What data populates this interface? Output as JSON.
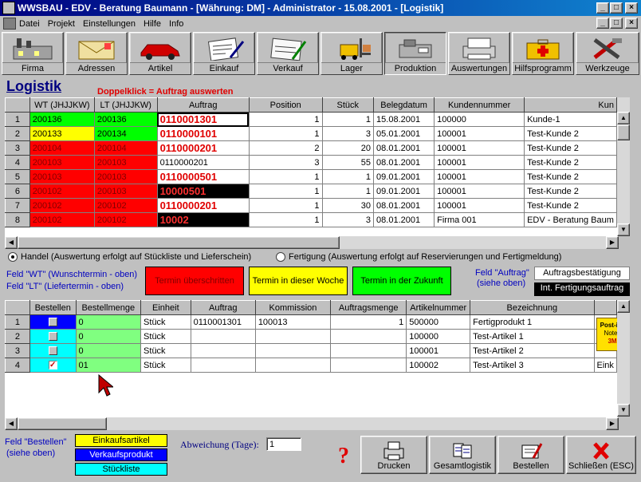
{
  "window": {
    "title": "WWSBAU - EDV - Beratung Baumann - [Währung: DM] - Administrator - 15.08.2001 - [Logistik]",
    "btn_min": "_",
    "btn_max": "□",
    "btn_close": "×"
  },
  "menu": [
    "Datei",
    "Projekt",
    "Einstellungen",
    "Hilfe",
    "Info"
  ],
  "toolbar": [
    "Firma",
    "Adressen",
    "Artikel",
    "Einkauf",
    "Verkauf",
    "Lager",
    "Produktion",
    "Auswertungen",
    "Hilfsprogramm",
    "Werkzeuge"
  ],
  "page": {
    "title": "Logistik",
    "hint": "Doppelklick = Auftrag auswerten"
  },
  "grid1": {
    "columns": [
      "WT (JHJJKW)",
      "LT (JHJJKW)",
      "Auftrag",
      "Position",
      "Stück",
      "Belegdatum",
      "Kundennummer",
      "Kun"
    ],
    "rows": [
      [
        "1",
        "200136",
        "200136",
        "0110001301",
        "1",
        "1",
        "15.08.2001",
        "100000",
        "Kunde-1"
      ],
      [
        "2",
        "200133",
        "200134",
        "0110000101",
        "1",
        "3",
        "05.01.2001",
        "100001",
        "Test-Kunde 2"
      ],
      [
        "3",
        "200104",
        "200104",
        "0110000201",
        "2",
        "20",
        "08.01.2001",
        "100001",
        "Test-Kunde 2"
      ],
      [
        "4",
        "200103",
        "200103",
        "0110000201",
        "3",
        "55",
        "08.01.2001",
        "100001",
        "Test-Kunde 2"
      ],
      [
        "5",
        "200103",
        "200103",
        "0110000501",
        "1",
        "1",
        "09.01.2001",
        "100001",
        "Test-Kunde 2"
      ],
      [
        "6",
        "200102",
        "200103",
        "10000501",
        "1",
        "1",
        "09.01.2001",
        "100001",
        "Test-Kunde 2"
      ],
      [
        "7",
        "200102",
        "200102",
        "0110000201",
        "1",
        "30",
        "08.01.2001",
        "100001",
        "Test-Kunde 2"
      ],
      [
        "8",
        "200102",
        "200102",
        "10002",
        "1",
        "3",
        "08.01.2001",
        "Firma 001",
        "EDV - Beratung Baum"
      ]
    ]
  },
  "radio": {
    "handel": "Handel (Auswertung erfolgt auf Stückliste und Lieferschein)",
    "fertigung": "Fertigung (Auswertung erfolgt auf Reservierungen und Fertigmeldung)"
  },
  "legend": {
    "note1": "Feld  \"WT\" (Wunschtermin - oben)",
    "note2": "Feld  \"LT\" (Liefertermin - oben)",
    "red": "Termin überschritten",
    "yellow": "Termin in dieser Woche",
    "green": "Termin in der Zukunft",
    "auftrag_note1": "Feld  \"Auftrag\"",
    "auftrag_note2": "(siehe oben)",
    "ab": "Auftragsbestätigung",
    "fa": "Int. Fertigungsauftrag"
  },
  "grid2": {
    "columns": [
      "Bestellen",
      "Bestellmenge",
      "Einheit",
      "Auftrag",
      "Kommission",
      "Auftragsmenge",
      "Artikelnummer",
      "Bezeichnung"
    ],
    "rows": [
      [
        "1",
        "",
        "0",
        "Stück",
        "0110001301",
        "100013",
        "1",
        "500000",
        "Fertigprodukt 1"
      ],
      [
        "2",
        "",
        "0",
        "Stück",
        "",
        "",
        "",
        "100000",
        "Test-Artikel 1"
      ],
      [
        "3",
        "",
        "0",
        "Stück",
        "",
        "",
        "",
        "100001",
        "Test-Artikel 2"
      ],
      [
        "4",
        "✓",
        "01",
        "Stück",
        "",
        "",
        "",
        "100002",
        "Test-Artikel 3"
      ]
    ],
    "overflow": "Eink"
  },
  "postit": {
    "line1": "Post-it®",
    "line2": "Notes",
    "line3": "3M"
  },
  "bottom": {
    "note1": "Feld  \"Bestellen\"",
    "note2": "(siehe oben)",
    "einkauf": "Einkaufsartikel",
    "verkauf": "Verkaufsprodukt",
    "stueck": "Stückliste",
    "abweichung_label": "Abweichung (Tage):",
    "abweichung_value": "1",
    "help": "?"
  },
  "commands": [
    "Drucken",
    "Gesamtlogistik",
    "Bestellen",
    "Schließen (ESC)"
  ]
}
